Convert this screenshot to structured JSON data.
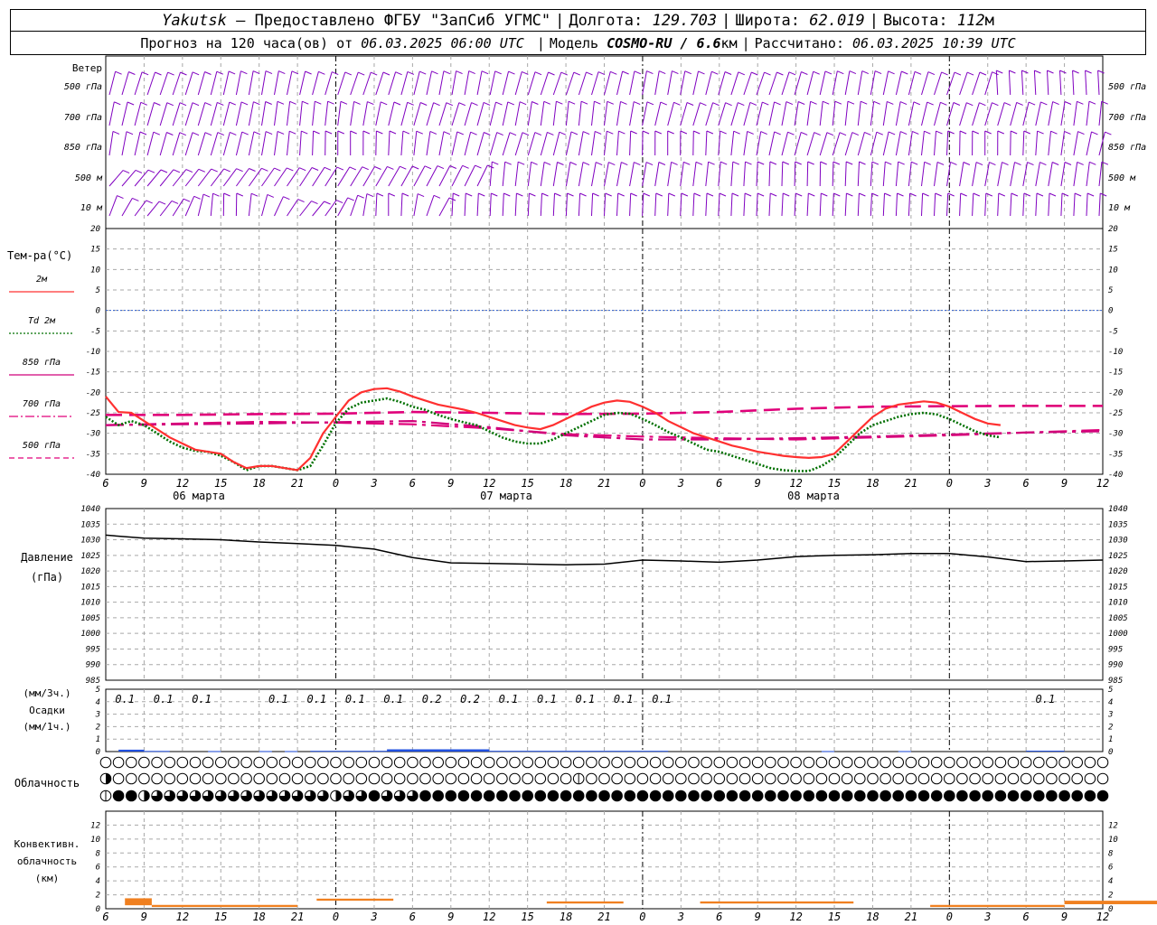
{
  "header": {
    "station": "Yakutsk",
    "provider_dash": "—",
    "provider": "Предоставлено ФГБУ \"ЗапСиб УГМС\"",
    "lon_label": "Долгота:",
    "lon": "129.703",
    "lat_label": "Широта:",
    "lat": "62.019",
    "alt_label": "Высота:",
    "alt": "112",
    "alt_unit": "м",
    "forecast_label": "Прогноз на 120 часа(ов) от",
    "forecast_from": "06.03.2025 06:00 UTC",
    "model_label": "Модель",
    "model": "COSMO-RU / 6.6",
    "model_unit": "км",
    "calc_label": "Рассчитано:",
    "calc_time": "06.03.2025 10:39 UTC"
  },
  "chart_data": {
    "type": "line",
    "time_ticks": [
      "6",
      "9",
      "12",
      "15",
      "18",
      "21",
      "0",
      "3",
      "6",
      "9",
      "12",
      "15",
      "18",
      "21",
      "0",
      "3",
      "6",
      "9",
      "12",
      "15",
      "18",
      "21",
      "0",
      "3",
      "6",
      "9",
      "12"
    ],
    "day_labels": [
      "06 марта",
      "07 марта",
      "08 марта"
    ],
    "wind": {
      "title": "Ветер",
      "levels": [
        "500 гПа",
        "700 гПа",
        "850 гПа",
        "500 м",
        "10 м"
      ],
      "color": "#8000c0"
    },
    "temperature": {
      "title": "Тем-ра(°С)",
      "ylim": [
        -40,
        20
      ],
      "yticks": [
        20,
        15,
        10,
        5,
        0,
        -5,
        -10,
        -15,
        -20,
        -25,
        -30,
        -35,
        -40
      ],
      "legend": [
        {
          "label": "2м",
          "style": "solid",
          "color": "#ff3030"
        },
        {
          "label": "Td 2м",
          "style": "dotted",
          "color": "#007000"
        },
        {
          "label": "850 гПа",
          "style": "solid",
          "color": "#d0007a"
        },
        {
          "label": "700 гПа",
          "style": "dashdot",
          "color": "#e0007a"
        },
        {
          "label": "500 гПа",
          "style": "dashed",
          "color": "#e0007a"
        }
      ],
      "series": [
        {
          "name": "2м",
          "color": "#ff3030",
          "x": [
            0,
            1,
            2,
            3,
            4,
            5,
            6,
            7,
            8,
            9,
            10,
            11,
            12,
            13,
            14,
            15,
            16,
            17,
            18,
            19,
            20,
            21,
            22,
            23,
            24,
            25,
            26,
            27,
            28,
            29,
            30,
            31,
            32,
            33,
            34,
            35,
            36,
            37,
            38,
            39,
            40,
            41,
            42,
            43,
            44,
            45,
            46,
            47,
            48,
            49,
            50,
            51,
            52,
            53,
            54,
            55,
            56,
            57,
            58,
            59,
            60,
            61,
            62,
            63,
            64,
            65,
            66,
            67,
            68,
            69,
            70,
            71,
            72,
            73,
            74,
            75,
            76,
            77,
            78
          ],
          "y": [
            -21,
            -24.8,
            -25,
            -27,
            -29,
            -31,
            -32.5,
            -34,
            -34.5,
            -35,
            -37,
            -38.5,
            -38,
            -38,
            -38.5,
            -39,
            -36,
            -30,
            -26,
            -22,
            -20,
            -19.2,
            -19,
            -19.8,
            -21,
            -22,
            -23,
            -23.6,
            -24.2,
            -25,
            -26,
            -27,
            -28,
            -28.6,
            -29,
            -28,
            -26.5,
            -25,
            -23.5,
            -22.5,
            -22,
            -22.3,
            -23.5,
            -25,
            -27,
            -28.5,
            -30,
            -31,
            -32,
            -33,
            -33.7,
            -34.5,
            -35,
            -35.5,
            -35.8,
            -36,
            -35.8,
            -35,
            -32,
            -29,
            -26,
            -24,
            -23,
            -22.6,
            -22.2,
            -22.5,
            -23.5,
            -25,
            -26.5,
            -27.6,
            -28
          ]
        },
        {
          "name": "Td 2м",
          "color": "#007000",
          "x": [
            0,
            1,
            2,
            3,
            4,
            5,
            6,
            7,
            8,
            9,
            10,
            11,
            12,
            13,
            14,
            15,
            16,
            17,
            18,
            19,
            20,
            21,
            22,
            23,
            24,
            25,
            26,
            27,
            28,
            29,
            30,
            31,
            32,
            33,
            34,
            35,
            36,
            37,
            38,
            39,
            40,
            41,
            42,
            43,
            44,
            45,
            46,
            47,
            48,
            49,
            50,
            51,
            52,
            53,
            54,
            55,
            56,
            57,
            58,
            59,
            60,
            61,
            62,
            63,
            64,
            65,
            66,
            67,
            68,
            69,
            70,
            71,
            72,
            73,
            74,
            75,
            76,
            77,
            78
          ],
          "y": [
            -26,
            -28,
            -27,
            -28,
            -30,
            -32,
            -33.5,
            -34.3,
            -34.5,
            -35.5,
            -37,
            -39,
            -38,
            -38,
            -38.5,
            -39,
            -38,
            -33,
            -27.5,
            -24,
            -22.5,
            -22,
            -21.5,
            -22.3,
            -23.5,
            -24.3,
            -25.5,
            -26.5,
            -27.3,
            -28,
            -29.5,
            -31,
            -32,
            -32.5,
            -32.5,
            -31.5,
            -30,
            -28.5,
            -27,
            -25.5,
            -25,
            -25.2,
            -26.5,
            -28,
            -29.7,
            -31,
            -32.5,
            -34,
            -34.5,
            -35.5,
            -36.5,
            -37.5,
            -38.5,
            -39,
            -39.2,
            -39.2,
            -38,
            -36,
            -33,
            -30,
            -28,
            -27,
            -26,
            -25.3,
            -25,
            -25.4,
            -26.5,
            -28,
            -29.5,
            -30.5,
            -31
          ]
        },
        {
          "name": "850 гПа",
          "color": "#d0007a",
          "x": [
            0,
            6,
            12,
            18,
            24,
            30,
            36,
            42,
            48,
            54,
            60,
            66,
            72,
            78
          ],
          "y": [
            -28,
            -27.8,
            -27.6,
            -27.3,
            -27,
            -28.5,
            -30.5,
            -31.5,
            -31.5,
            -31.2,
            -30.8,
            -30.3,
            -29.8,
            -29.5
          ]
        },
        {
          "name": "700 гПа",
          "color": "#e0007a",
          "x": [
            0,
            6,
            12,
            18,
            24,
            30,
            36,
            42,
            48,
            54,
            60,
            66,
            72,
            78
          ],
          "y": [
            -28,
            -27.6,
            -27.2,
            -27.4,
            -27.8,
            -28.8,
            -30.2,
            -30.8,
            -31.2,
            -31.5,
            -31,
            -30.5,
            -29.8,
            -29.2
          ]
        },
        {
          "name": "500 гПа",
          "color": "#e0007a",
          "x": [
            0,
            6,
            12,
            18,
            24,
            30,
            36,
            42,
            48,
            54,
            60,
            66,
            72,
            78
          ],
          "y": [
            -25.5,
            -25.5,
            -25.3,
            -25.2,
            -24.8,
            -25,
            -25.3,
            -25.2,
            -24.8,
            -24,
            -23.5,
            -23.4,
            -23.3,
            -23.3
          ]
        }
      ]
    },
    "pressure": {
      "title": "Давление",
      "unit": "(гПа)",
      "ylim": [
        985,
        1040
      ],
      "yticks": [
        1040,
        1035,
        1030,
        1025,
        1020,
        1015,
        1010,
        1005,
        1000,
        995,
        990,
        985
      ],
      "x": [
        0,
        3,
        6,
        9,
        12,
        15,
        18,
        21,
        24,
        27,
        30,
        33,
        36,
        39,
        42,
        45,
        48,
        51,
        54,
        57,
        60,
        63,
        66,
        69,
        72,
        75,
        78
      ],
      "y": [
        1031.5,
        1030.5,
        1030.3,
        1030,
        1029.3,
        1028.8,
        1028.2,
        1027,
        1024.3,
        1022.6,
        1022.4,
        1022.2,
        1022,
        1022.2,
        1023.5,
        1023.2,
        1022.8,
        1023.5,
        1024.6,
        1025,
        1025.2,
        1025.6,
        1025.6,
        1024.5,
        1023,
        1023.2,
        1023.5
      ],
      "color": "#000000"
    },
    "precipitation": {
      "title": "Осадки",
      "unit_3h": "(мм/3ч.)",
      "unit_1h": "(мм/1ч.)",
      "ylim": [
        0,
        5
      ],
      "yticks": [
        5,
        4,
        3,
        2,
        1,
        0
      ],
      "labels": [
        {
          "x": 1.5,
          "text": "0.1"
        },
        {
          "x": 4.5,
          "text": "0.1"
        },
        {
          "x": 7.5,
          "text": "0.1"
        },
        {
          "x": 13.5,
          "text": "0.1"
        },
        {
          "x": 16.5,
          "text": "0.1"
        },
        {
          "x": 19.5,
          "text": "0.1"
        },
        {
          "x": 22.5,
          "text": "0.1"
        },
        {
          "x": 25.5,
          "text": "0.2"
        },
        {
          "x": 28.5,
          "text": "0.2"
        },
        {
          "x": 31.5,
          "text": "0.1"
        },
        {
          "x": 34.5,
          "text": "0.1"
        },
        {
          "x": 37.5,
          "text": "0.1"
        },
        {
          "x": 40.5,
          "text": "0.1"
        },
        {
          "x": 43.5,
          "text": "0.1"
        },
        {
          "x": 73.5,
          "text": "0.1"
        }
      ],
      "bars": [
        {
          "x0": 1,
          "x1": 3,
          "v": 0.15
        },
        {
          "x0": 3,
          "x1": 5,
          "v": 0.05
        },
        {
          "x0": 8,
          "x1": 9,
          "v": 0.04
        },
        {
          "x0": 12,
          "x1": 13,
          "v": 0.04
        },
        {
          "x0": 14,
          "x1": 15,
          "v": 0.04
        },
        {
          "x0": 16,
          "x1": 22,
          "v": 0.06
        },
        {
          "x0": 22,
          "x1": 30,
          "v": 0.18
        },
        {
          "x0": 30,
          "x1": 44,
          "v": 0.06
        },
        {
          "x0": 56,
          "x1": 57,
          "v": 0.04
        },
        {
          "x0": 62,
          "x1": 63,
          "v": 0.04
        },
        {
          "x0": 72,
          "x1": 75,
          "v": 0.07
        }
      ],
      "color": "#2050e0"
    },
    "cloudiness": {
      "title": "Облачность",
      "rows": [
        [
          0,
          0,
          0,
          0,
          0,
          0,
          0,
          0,
          0,
          0,
          0,
          0,
          0,
          0,
          0,
          0,
          0,
          0,
          0,
          0,
          0,
          0,
          0,
          0,
          0,
          0,
          0,
          0,
          0,
          0,
          0,
          0,
          0,
          0,
          0,
          0,
          0,
          0,
          0,
          0,
          0,
          0,
          0,
          0,
          0,
          0,
          0,
          0,
          0,
          0,
          0,
          0,
          0,
          0,
          0,
          0,
          0,
          0,
          0,
          0,
          0,
          0,
          0,
          0,
          0,
          0,
          0,
          0,
          0,
          0,
          0,
          0,
          0,
          0,
          0,
          0,
          0,
          0,
          0
        ],
        [
          2,
          0,
          0,
          0,
          0,
          0,
          0,
          0,
          0,
          0,
          0,
          0,
          0,
          0,
          0,
          0,
          0,
          0,
          0,
          0,
          0,
          0,
          0,
          0,
          0,
          0,
          0,
          0,
          0,
          0,
          0,
          0,
          0,
          0,
          0,
          0,
          0,
          1,
          0,
          0,
          0,
          0,
          0,
          0,
          0,
          0,
          0,
          0,
          0,
          0,
          0,
          0,
          0,
          0,
          0,
          0,
          0,
          0,
          0,
          0,
          0,
          0,
          0,
          0,
          0,
          0,
          0,
          0,
          0,
          0,
          0,
          0,
          0,
          0,
          0,
          0,
          0,
          0,
          0
        ],
        [
          1,
          4,
          4,
          2,
          3,
          3,
          3,
          3,
          3,
          3,
          3,
          3,
          3,
          3,
          3,
          3,
          3,
          3,
          2,
          3,
          3,
          4,
          3,
          3,
          3,
          4,
          4,
          4,
          4,
          4,
          4,
          4,
          4,
          4,
          4,
          4,
          4,
          4,
          4,
          4,
          4,
          4,
          4,
          4,
          4,
          4,
          4,
          4,
          4,
          4,
          4,
          4,
          4,
          4,
          4,
          4,
          4,
          4,
          4,
          4,
          4,
          4,
          4,
          4,
          4,
          4,
          4,
          4,
          4,
          4,
          4,
          4,
          4,
          4,
          4,
          4,
          4,
          4,
          4
        ]
      ]
    },
    "convective": {
      "title": "Конвективн.",
      "title2": "облачность",
      "unit": "(км)",
      "ylim": [
        0,
        14
      ],
      "yticks": [
        12,
        10,
        8,
        6,
        4,
        2,
        0
      ],
      "bars": [
        {
          "x0": 0.5,
          "x1": 1.2,
          "v": 1.0,
          "h": 1.0
        },
        {
          "x0": 1.2,
          "x1": 5,
          "v": 0.4,
          "h": 0.3
        },
        {
          "x0": 5.5,
          "x1": 7.5,
          "v": 1.3,
          "h": 0.3
        },
        {
          "x0": 11.5,
          "x1": 13.5,
          "v": 0.9,
          "h": 0.3
        },
        {
          "x0": 15.5,
          "x1": 19.5,
          "v": 0.9,
          "h": 0.3
        },
        {
          "x0": 21.5,
          "x1": 25,
          "v": 0.4,
          "h": 0.3
        },
        {
          "x0": 25,
          "x1": 28,
          "v": 0.9,
          "h": 0.5
        },
        {
          "x0": 28,
          "x1": 36,
          "v": 0.4,
          "h": 0.3
        },
        {
          "x0": 38.5,
          "x1": 43.5,
          "v": 1.3,
          "h": 0.3
        },
        {
          "x0": 44,
          "x1": 49,
          "v": 0.4,
          "h": 0.3
        },
        {
          "x0": 69,
          "x1": 71.5,
          "v": 0.4,
          "h": 0.3
        },
        {
          "x0": 71.5,
          "x1": 74.5,
          "v": 0.5,
          "h": 0.3
        }
      ],
      "color": "#f08020"
    }
  }
}
